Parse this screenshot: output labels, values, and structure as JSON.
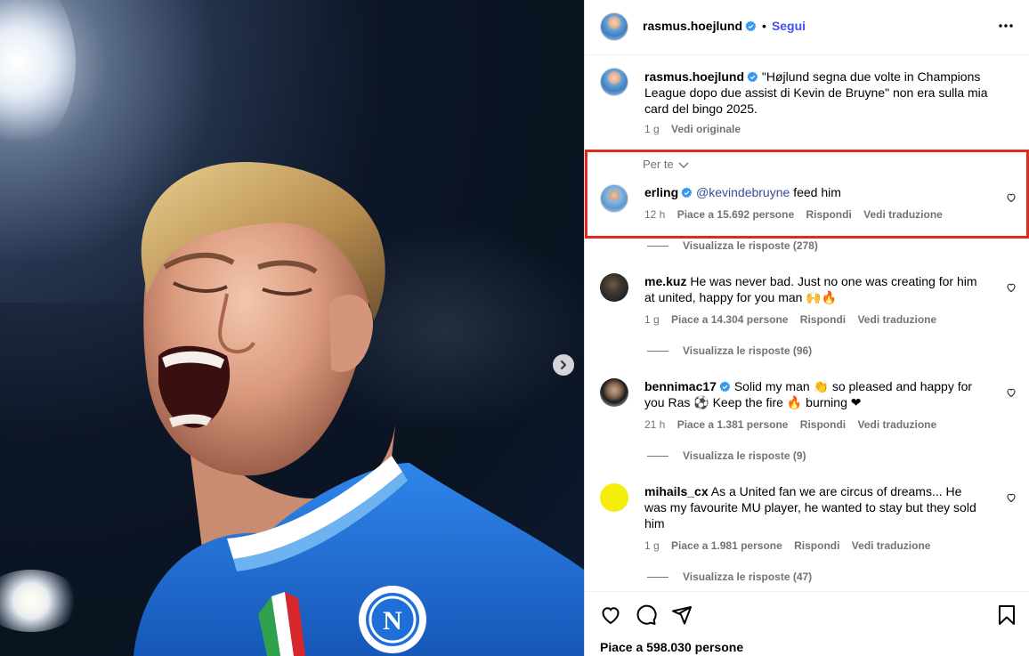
{
  "post": {
    "author": "rasmus.hoejlund",
    "follow_label": "Segui",
    "dot": "•",
    "caption_user": "rasmus.hoejlund",
    "caption_line1": "\"Højlund segna due volte in Champions",
    "caption_line2": "League dopo due assist di Kevin de Bruyne\" non era sulla mia",
    "caption_line3": "card del bingo 2025.",
    "caption_time": "1 g",
    "see_original": "Vedi originale",
    "likes_total": "Piace a 598.030 persone"
  },
  "filter": {
    "label": "Per te"
  },
  "comments": [
    {
      "user": "erling",
      "verified": true,
      "mention": "@kevindebruyne",
      "text_line1": "feed him",
      "time": "12 h",
      "likes": "Piace a 15.692 persone",
      "reply": "Rispondi",
      "translate": "Vedi traduzione",
      "replies": "Visualizza le risposte (278)"
    },
    {
      "user": "me.kuz",
      "verified": false,
      "text_line1": "He was never bad. Just no one was creating for him",
      "text_line2": "at united, happy for you man 🙌🔥",
      "time": "1 g",
      "likes": "Piace a 14.304 persone",
      "reply": "Rispondi",
      "translate": "Vedi traduzione",
      "replies": "Visualizza le risposte (96)"
    },
    {
      "user": "bennimac17",
      "verified": true,
      "text_line1": "Solid my man 👏 so pleased and happy for",
      "text_line2": "you Ras ⚽ Keep the fire 🔥 burning ❤",
      "time": "21 h",
      "likes": "Piace a 1.381 persone",
      "reply": "Rispondi",
      "translate": "Vedi traduzione",
      "replies": "Visualizza le risposte (9)"
    },
    {
      "user": "mihails_cx",
      "verified": false,
      "text_line1": "As a United fan we are circus of dreams... He",
      "text_line2": "was my favourite MU player, he wanted to stay but they sold",
      "text_line3": "him",
      "time": "1 g",
      "likes": "Piace a 1.981 persone",
      "reply": "Rispondi",
      "translate": "Vedi traduzione",
      "replies": "Visualizza le risposte (47)"
    }
  ],
  "icons": {
    "verified": "verified-badge-icon",
    "more": "more-options-icon",
    "heart": "heart-icon",
    "like": "like-heart-icon",
    "comment": "comment-bubble-icon",
    "share": "share-paper-plane-icon",
    "save": "bookmark-icon",
    "next": "chevron-right-icon",
    "dropdown": "chevron-down-icon"
  },
  "colors": {
    "accent": "#4150F7",
    "verified": "#3897F0",
    "highlight": "#E0291F",
    "jersey": "#1F6FD8",
    "muted": "#737373"
  }
}
